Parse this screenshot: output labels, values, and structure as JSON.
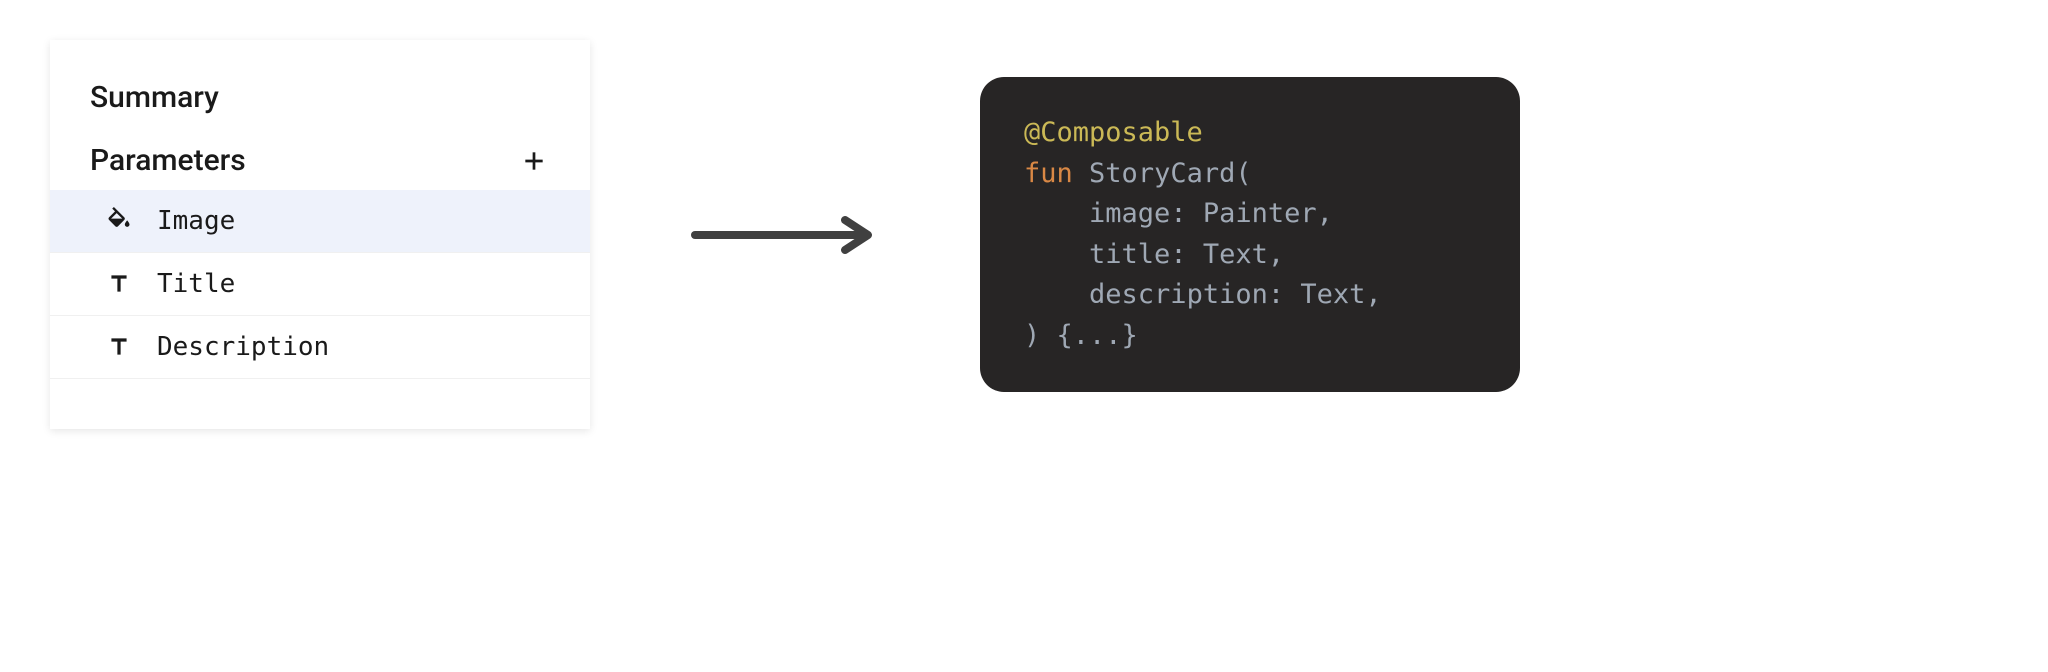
{
  "panel": {
    "summary_label": "Summary",
    "parameters_label": "Parameters",
    "items": [
      {
        "label": "Image",
        "icon": "fill",
        "selected": true
      },
      {
        "label": "Title",
        "icon": "text",
        "selected": false
      },
      {
        "label": "Description",
        "icon": "text",
        "selected": false
      }
    ]
  },
  "code": {
    "annotation": "@Composable",
    "keyword": "fun",
    "function_name": "StoryCard",
    "params": [
      {
        "name": "image",
        "type": "Painter"
      },
      {
        "name": "title",
        "type": "Text"
      },
      {
        "name": "description",
        "type": "Text"
      }
    ],
    "body": "{...}"
  }
}
